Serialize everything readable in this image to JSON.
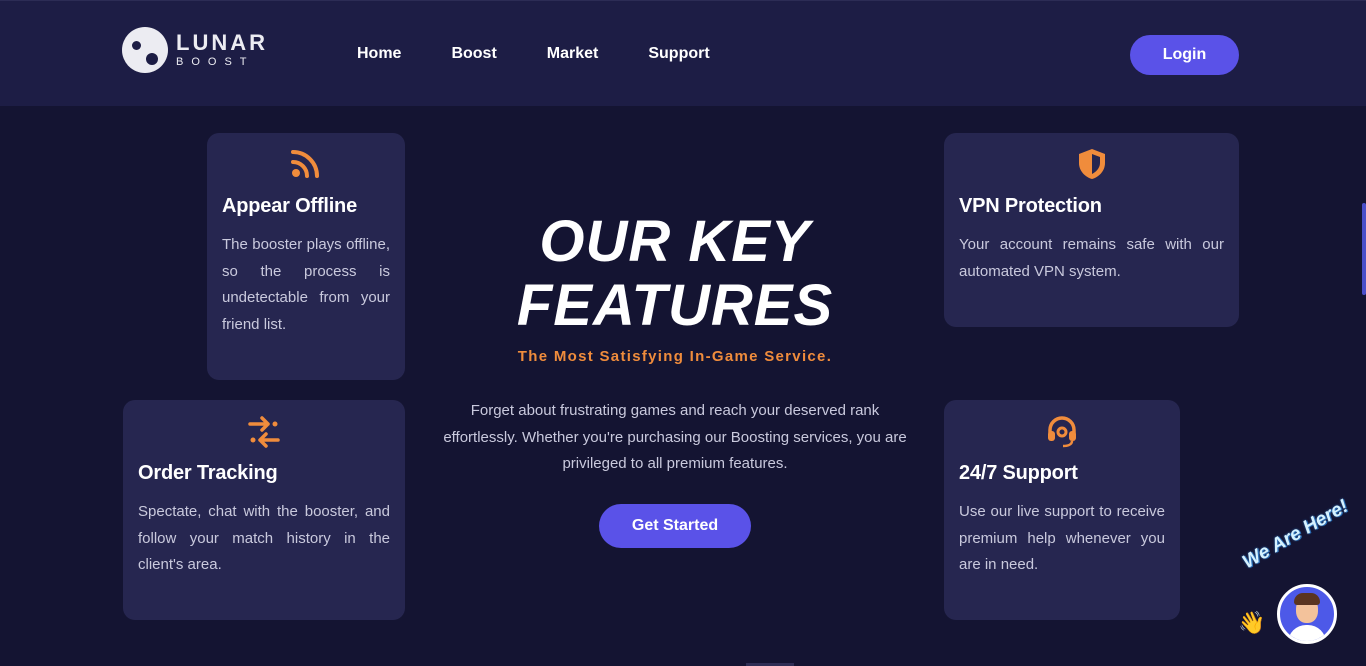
{
  "nav": {
    "logo": {
      "main": "LUNAR",
      "sub": "BOOST"
    },
    "links": [
      "Home",
      "Boost",
      "Market",
      "Support"
    ],
    "login_label": "Login"
  },
  "colors": {
    "accent": "#5a52e8",
    "orange": "#f08c3c",
    "background": "#141432",
    "card": "#262650"
  },
  "features": {
    "offline": {
      "icon": "rss-icon",
      "title": "Appear Offline",
      "text": "The booster plays offline, so the process is undetectable from your friend list."
    },
    "tracking": {
      "icon": "arrows-exchange-icon",
      "title": "Order Tracking",
      "text": "Spectate, chat with the booster, and follow your match history in the client's area."
    },
    "vpn": {
      "icon": "shield-icon",
      "title": "VPN Protection",
      "text": "Your account remains safe with our automated VPN system."
    },
    "support": {
      "icon": "headset-icon",
      "title": "24/7 Support",
      "text": "Use our live support to receive premium help whenever you are in need."
    }
  },
  "hero": {
    "title_line1": "OUR KEY",
    "title_line2": "FEATURES",
    "subtitle": "The Most Satisfying In-Game Service.",
    "description": "Forget about frustrating games and reach your deserved rank effortlessly. Whether you're purchasing our Boosting services, you are privileged to all premium features.",
    "cta_label": "Get Started"
  },
  "chat": {
    "tagline": "We Are Here!",
    "icon": "waving-hand-icon"
  }
}
